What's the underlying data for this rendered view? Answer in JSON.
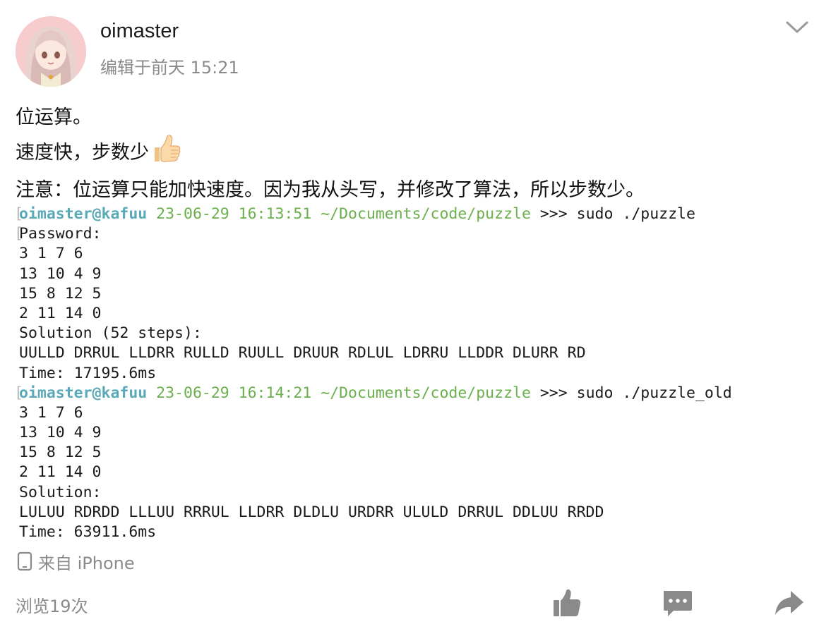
{
  "post": {
    "author": "oimaster",
    "edited_time": "编辑于前天 15:21",
    "lines": [
      "位运算。",
      "速度快，步数少",
      "注意：位运算只能加快速度。因为我从头写，并修改了算法，所以步数少。"
    ],
    "emoji": "thumbs-up-icon"
  },
  "terminal": {
    "run1": {
      "user": "oimaster@kafuu",
      "timestamp": "23-06-29 16:13:51",
      "path": "~/Documents/code/puzzle",
      "prompt": ">>>",
      "command": "sudo ./puzzle",
      "output": [
        "Password:",
        "3 1 7 6",
        "13 10 4 9",
        "15 8 12 5",
        "2 11 14 0",
        "Solution (52 steps):",
        "UULLD DRRUL LLDRR RULLD RUULL DRUUR RDLUL LDRRU LLDDR DLURR RD",
        "Time: 17195.6ms"
      ]
    },
    "run2": {
      "user": "oimaster@kafuu",
      "timestamp": "23-06-29 16:14:21",
      "path": "~/Documents/code/puzzle",
      "prompt": ">>>",
      "command": "sudo ./puzzle_old",
      "output": [
        "3 1 7 6",
        "13 10 4 9",
        "15 8 12 5",
        "2 11 14 0",
        "Solution:",
        "LULUU RDRDD LLLUU RRRUL LLDRR DLDLU URDRR ULULD DRRUL DDLUU RRDD",
        "Time: 63911.6ms"
      ]
    },
    "colors": {
      "user": "#5aa9b8",
      "date": "#6ab04c",
      "path": "#6ab04c"
    }
  },
  "footer": {
    "source": "来自 iPhone",
    "source_icon": "phone-icon",
    "views": "浏览19次",
    "actions": [
      "like-icon",
      "comment-icon",
      "share-icon"
    ]
  }
}
